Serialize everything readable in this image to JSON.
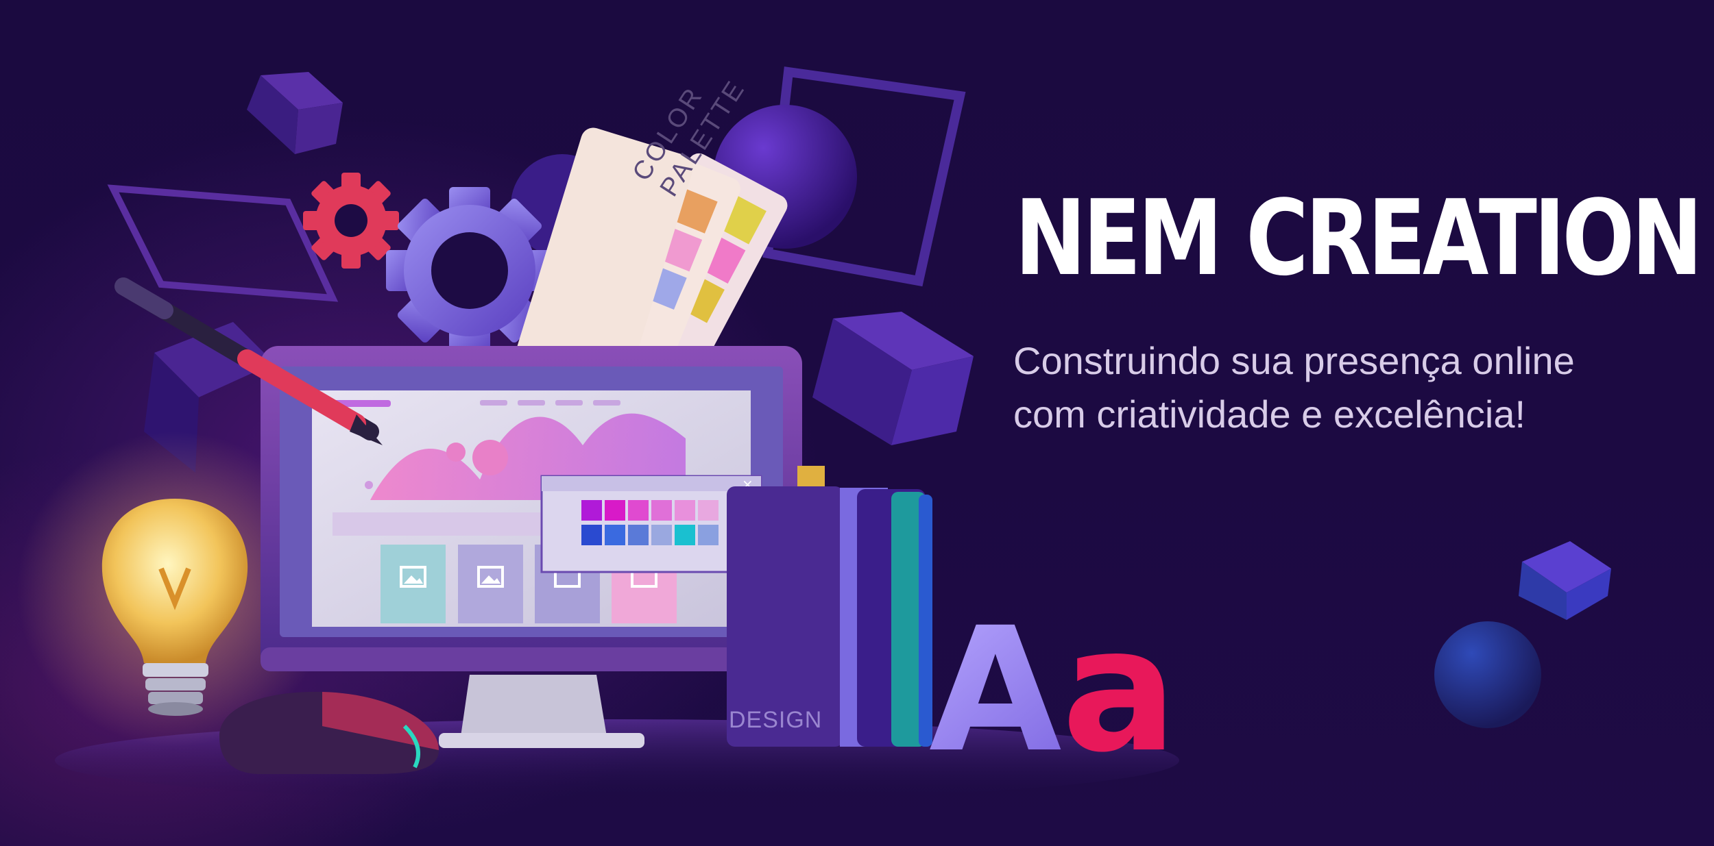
{
  "brand": {
    "headline": "NEM CREATION",
    "tagline_line1": "Construindo sua presença online",
    "tagline_line2": "com criatividade e excelência!"
  },
  "illustration": {
    "palette_card_label_line1": "COLOR",
    "palette_card_label_line2": "PALETTE",
    "book_label": "DESIGN",
    "letters": "Aa",
    "window_close": "×"
  },
  "colors": {
    "background": "#1b0a40",
    "accent_pink": "#e8185a",
    "accent_purple": "#7a4fd0",
    "headline": "#ffffff",
    "tagline": "#d8cce8"
  },
  "icons": [
    "gear-icon",
    "light-bulb-icon",
    "pen-icon",
    "mouse-icon",
    "image-icon",
    "close-icon",
    "cube-icon",
    "sphere-icon"
  ]
}
